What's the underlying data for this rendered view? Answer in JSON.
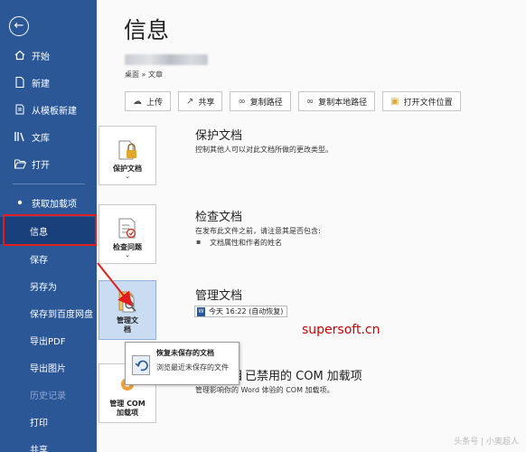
{
  "sidebar": {
    "back_icon": "back-arrow-icon",
    "items": [
      {
        "label": "开始",
        "icon": "home-icon"
      },
      {
        "label": "新建",
        "icon": "new-doc-icon"
      },
      {
        "label": "从模板新建",
        "icon": "template-icon"
      },
      {
        "label": "文库",
        "icon": "library-icon"
      },
      {
        "label": "打开",
        "icon": "folder-open-icon"
      },
      {
        "label": "获取加载项",
        "icon": "dot-icon"
      },
      {
        "label": "信息"
      },
      {
        "label": "保存"
      },
      {
        "label": "另存为"
      },
      {
        "label": "保存到百度网盘"
      },
      {
        "label": "导出PDF"
      },
      {
        "label": "导出图片"
      },
      {
        "label": "历史记录"
      },
      {
        "label": "打印"
      },
      {
        "label": "共享"
      }
    ],
    "accent": "#2b5797",
    "highlight_color": "#e21d1d"
  },
  "main": {
    "title": "信息",
    "path": "桌面 » 文章",
    "toolbar": [
      {
        "label": "上传",
        "icon": "upload-icon"
      },
      {
        "label": "共享",
        "icon": "share-icon"
      },
      {
        "label": "复制路径",
        "icon": "link-icon"
      },
      {
        "label": "复制本地路径",
        "icon": "link-icon"
      },
      {
        "label": "打开文件位置",
        "icon": "folder-icon"
      }
    ],
    "protect": {
      "tile_label": "保护文档",
      "title": "保护文档",
      "desc": "控制其他人可以对此文档所做的更改类型。"
    },
    "inspect": {
      "tile_label": "检查问题",
      "title": "检查文档",
      "desc": "在发布此文件之前，请注意其是否包含:",
      "bullet": "文档属性和作者的姓名"
    },
    "manage": {
      "tile_label_1": "管理文",
      "tile_label_2": "档",
      "title": "管理文档",
      "version": "今天 16:22 (自动恢复)"
    },
    "popup": {
      "title": "恢复未保存的文档",
      "desc": "浏览最近未保存的文件"
    },
    "com": {
      "tile_label_1": "管理 COM",
      "tile_label_2": "加载项",
      "title": "已禁用的 COM 加载项",
      "title_prefix": "目",
      "desc": "管理影响你的 Word 体验的 COM 加载项。"
    },
    "watermark": "supersoft.cn",
    "credit": "头条号 | 小奥超人"
  }
}
